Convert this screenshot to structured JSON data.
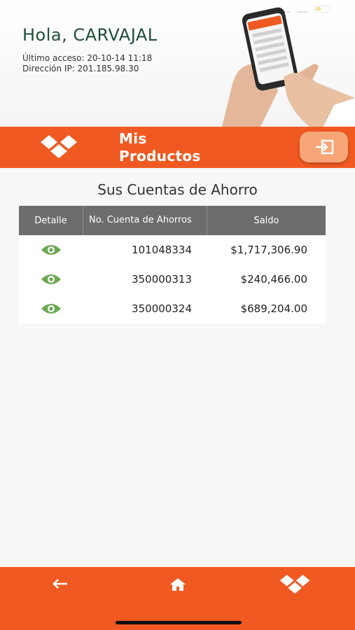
{
  "greeting": "Hola, CARVAJAL",
  "last_access": "Último acceso: 20-10-14 11:18",
  "ip_address": "Dirección IP: 201.185.98.30",
  "header": {
    "title_line1": "Mis",
    "title_line2": "Productos"
  },
  "section_title": "Sus Cuentas de Ahorro",
  "table": {
    "columns": [
      "Detalle",
      "No. Cuenta de Ahorros",
      "Saldo"
    ],
    "rows": [
      {
        "account": "101048334",
        "balance": "$1,717,306.90"
      },
      {
        "account": "350000313",
        "balance": "$240,466.00"
      },
      {
        "account": "350000324",
        "balance": "$689,204.00"
      }
    ]
  },
  "icons": {
    "detail": "eye-icon",
    "logout": "logout-icon",
    "logo": "brand-logo-icon",
    "back": "back-arrow-icon",
    "home": "home-icon"
  },
  "colors": {
    "brand_orange": "#f05a22",
    "logout_button": "#f8a678",
    "table_header": "#6d6d6d",
    "eye_green": "#6aa84f",
    "greeting_green": "#1f4d36"
  }
}
